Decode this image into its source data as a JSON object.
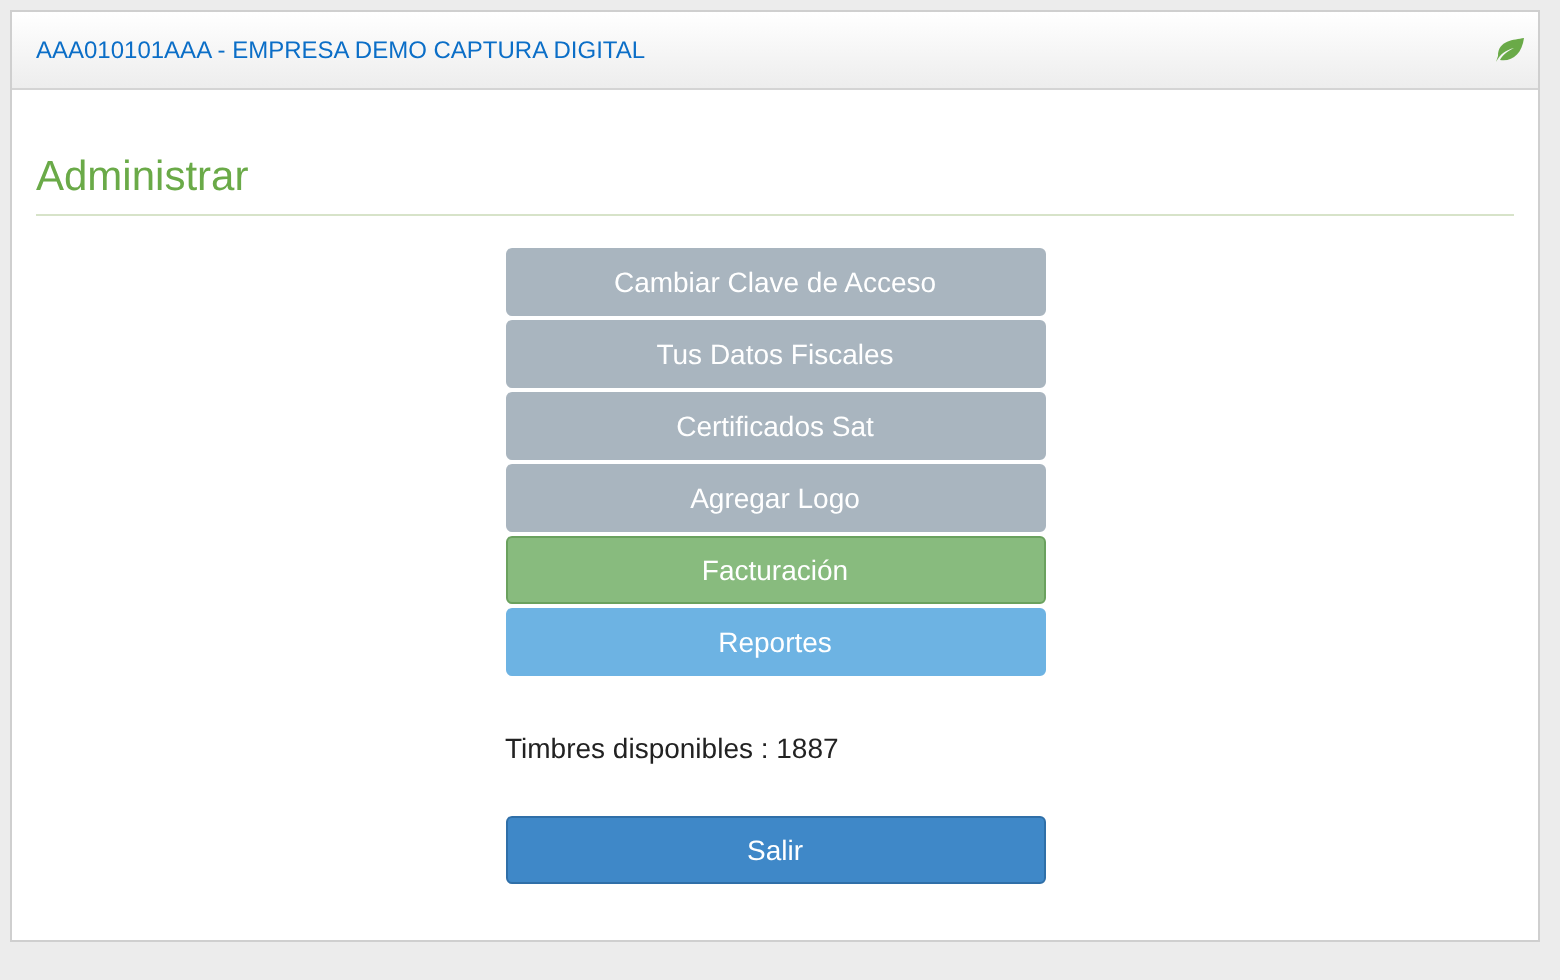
{
  "panel": {
    "title": "AAA010101AAA - EMPRESA DEMO CAPTURA DIGITAL"
  },
  "section_title": "Administrar",
  "menu_buttons": [
    {
      "label": "Cambiar Clave de Acceso",
      "kind": "default"
    },
    {
      "label": "Tus Datos Fiscales",
      "kind": "default"
    },
    {
      "label": "Certificados Sat",
      "kind": "default"
    },
    {
      "label": "Agregar Logo",
      "kind": "default"
    },
    {
      "label": "Facturación",
      "kind": "success"
    },
    {
      "label": "Reportes",
      "kind": "info"
    }
  ],
  "stamps_text": "Timbres disponibles : 1887",
  "exit_button": {
    "label": "Salir",
    "kind": "primary"
  }
}
